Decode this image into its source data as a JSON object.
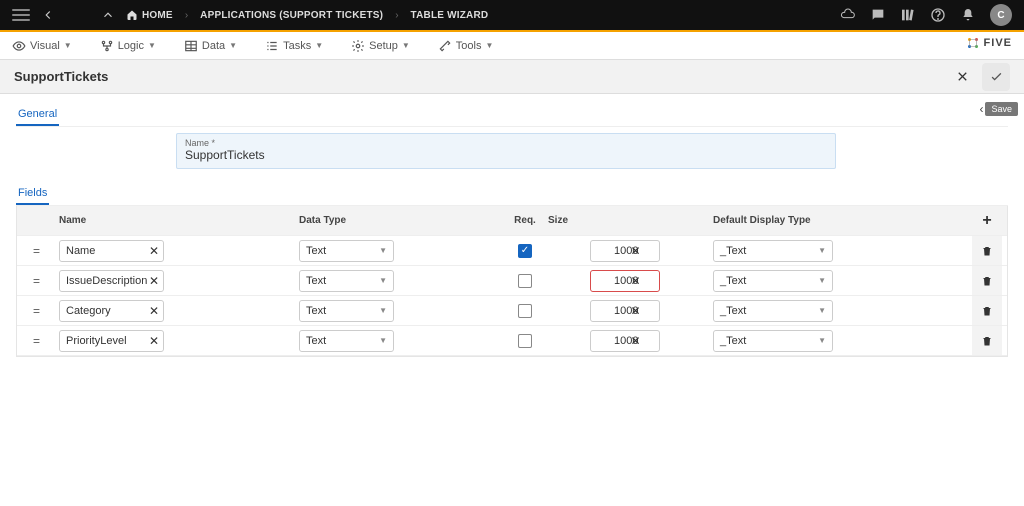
{
  "topbar": {
    "breadcrumbs": [
      {
        "label": "HOME",
        "icon": "home"
      },
      {
        "label": "APPLICATIONS (SUPPORT TICKETS)"
      },
      {
        "label": "TABLE WIZARD"
      }
    ],
    "avatar_initial": "C"
  },
  "menubar": {
    "items": [
      {
        "label": "Visual",
        "icon": "eye"
      },
      {
        "label": "Logic",
        "icon": "logic"
      },
      {
        "label": "Data",
        "icon": "grid"
      },
      {
        "label": "Tasks",
        "icon": "tasks"
      },
      {
        "label": "Setup",
        "icon": "gear"
      },
      {
        "label": "Tools",
        "icon": "wrench"
      }
    ],
    "brand": "FIVE"
  },
  "page": {
    "title": "SupportTickets",
    "tab_general": "General",
    "tab_fields": "Fields",
    "save_label": "Save",
    "name_field_label": "Name *",
    "name_field_value": "SupportTickets"
  },
  "columns": {
    "name": "Name",
    "data_type": "Data Type",
    "req": "Req.",
    "size": "Size",
    "display": "Default Display Type"
  },
  "rows": [
    {
      "name": "Name",
      "data_type": "Text",
      "req": true,
      "size": "1000",
      "size_error": false,
      "display": "_Text"
    },
    {
      "name": "IssueDescription",
      "data_type": "Text",
      "req": false,
      "size": "1000",
      "size_error": true,
      "display": "_Text"
    },
    {
      "name": "Category",
      "data_type": "Text",
      "req": false,
      "size": "1000",
      "size_error": false,
      "display": "_Text"
    },
    {
      "name": "PriorityLevel",
      "data_type": "Text",
      "req": false,
      "size": "1000",
      "size_error": false,
      "display": "_Text"
    }
  ]
}
